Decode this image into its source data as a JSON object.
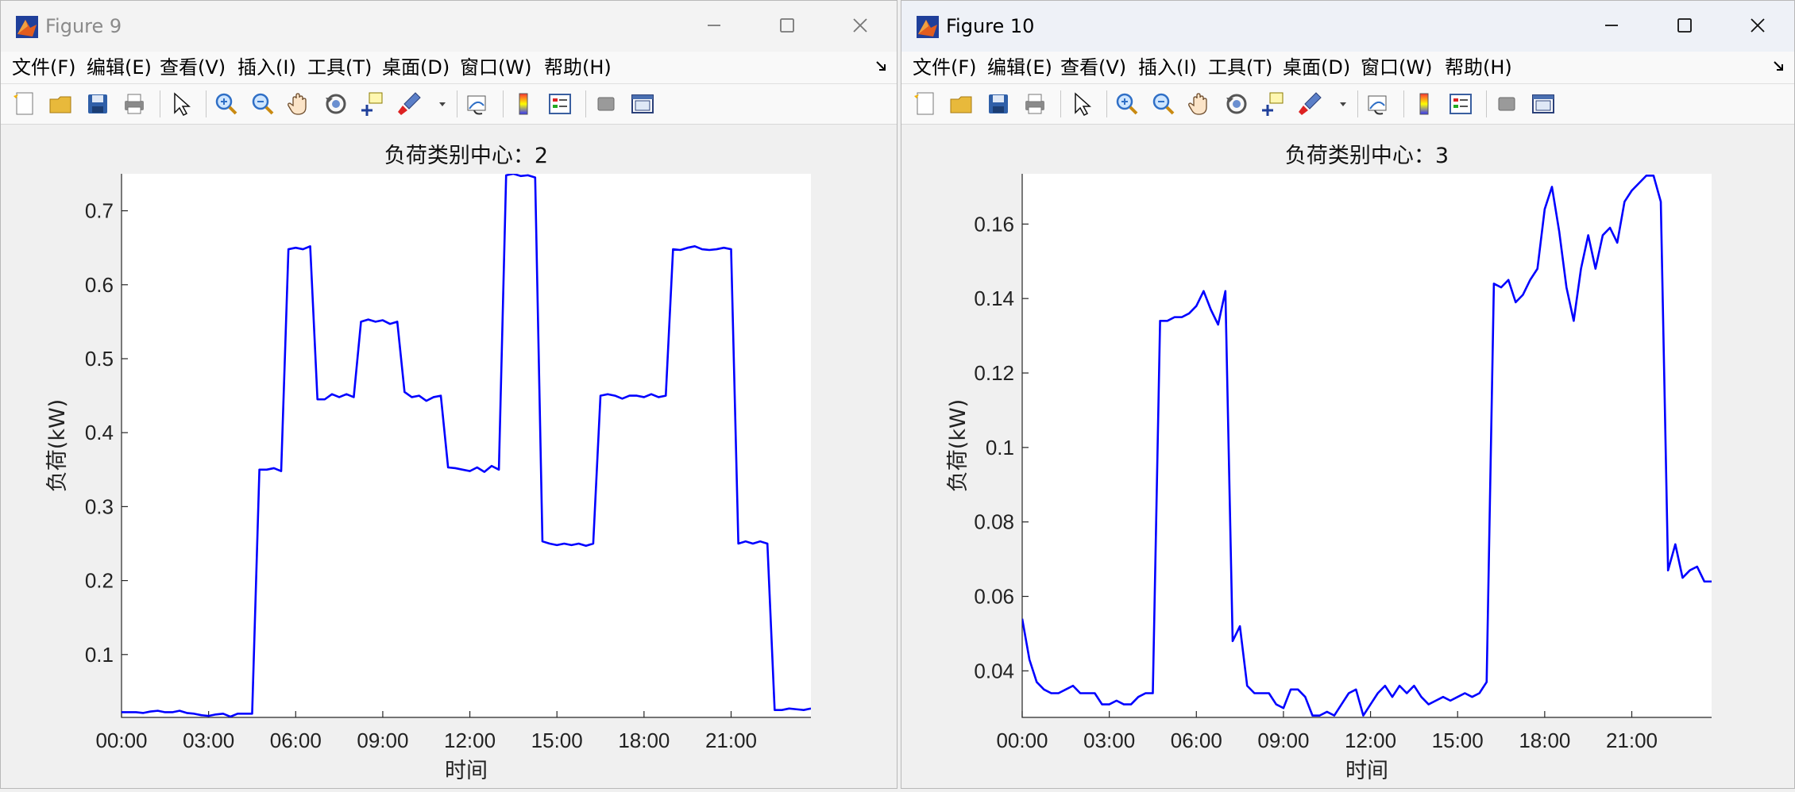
{
  "menu": [
    "文件(F)",
    "编辑(E)",
    "查看(V)",
    "插入(I)",
    "工具(T)",
    "桌面(D)",
    "窗口(W)",
    "帮助(H)"
  ],
  "windows": [
    {
      "title": "Figure 9",
      "active": false,
      "chart_data": {
        "type": "line",
        "title": "负荷类别中心：2",
        "xlabel": "时间",
        "ylabel": "负荷(kW)",
        "color": "#0000ff",
        "xlim": [
          0,
          95
        ],
        "ylim": [
          0.015,
          0.75
        ],
        "xticks": [
          0,
          12,
          24,
          36,
          48,
          60,
          72,
          84
        ],
        "xticklabels": [
          "00:00",
          "03:00",
          "06:00",
          "09:00",
          "12:00",
          "15:00",
          "18:00",
          "21:00"
        ],
        "yticks": [
          0.1,
          0.2,
          0.3,
          0.4,
          0.5,
          0.6,
          0.7
        ],
        "yticklabels": [
          "0.1",
          "0.2",
          "0.3",
          "0.4",
          "0.5",
          "0.6",
          "0.7"
        ],
        "grid": false,
        "values": [
          0.022,
          0.022,
          0.022,
          0.021,
          0.023,
          0.024,
          0.022,
          0.022,
          0.024,
          0.021,
          0.02,
          0.018,
          0.017,
          0.019,
          0.02,
          0.016,
          0.02,
          0.02,
          0.02,
          0.35,
          0.35,
          0.352,
          0.348,
          0.648,
          0.65,
          0.648,
          0.652,
          0.445,
          0.445,
          0.452,
          0.448,
          0.452,
          0.448,
          0.55,
          0.553,
          0.55,
          0.552,
          0.547,
          0.55,
          0.455,
          0.448,
          0.45,
          0.443,
          0.448,
          0.45,
          0.353,
          0.352,
          0.35,
          0.348,
          0.353,
          0.347,
          0.355,
          0.35,
          0.748,
          0.75,
          0.747,
          0.748,
          0.745,
          0.253,
          0.25,
          0.248,
          0.25,
          0.248,
          0.25,
          0.247,
          0.25,
          0.45,
          0.452,
          0.45,
          0.446,
          0.45,
          0.45,
          0.448,
          0.452,
          0.448,
          0.45,
          0.648,
          0.647,
          0.65,
          0.652,
          0.648,
          0.647,
          0.648,
          0.65,
          0.648,
          0.25,
          0.253,
          0.25,
          0.253,
          0.25,
          0.025,
          0.025,
          0.027,
          0.026,
          0.025,
          0.027
        ]
      }
    },
    {
      "title": "Figure 10",
      "active": true,
      "chart_data": {
        "type": "line",
        "title": "负荷类别中心：3",
        "xlabel": "时间",
        "ylabel": "负荷(kW)",
        "color": "#0000ff",
        "xlim": [
          0,
          95
        ],
        "ylim": [
          0.0275,
          0.1735
        ],
        "xticks": [
          0,
          12,
          24,
          36,
          48,
          60,
          72,
          84
        ],
        "xticklabels": [
          "00:00",
          "03:00",
          "06:00",
          "09:00",
          "12:00",
          "15:00",
          "18:00",
          "21:00"
        ],
        "yticks": [
          0.04,
          0.06,
          0.08,
          0.1,
          0.12,
          0.14,
          0.16
        ],
        "yticklabels": [
          "0.04",
          "0.06",
          "0.08",
          "0.1",
          "0.12",
          "0.14",
          "0.16"
        ],
        "grid": false,
        "values": [
          0.054,
          0.043,
          0.037,
          0.035,
          0.034,
          0.034,
          0.035,
          0.036,
          0.034,
          0.034,
          0.034,
          0.031,
          0.031,
          0.032,
          0.031,
          0.031,
          0.033,
          0.034,
          0.034,
          0.134,
          0.134,
          0.135,
          0.135,
          0.136,
          0.138,
          0.142,
          0.137,
          0.133,
          0.142,
          0.048,
          0.052,
          0.036,
          0.034,
          0.034,
          0.034,
          0.031,
          0.03,
          0.035,
          0.035,
          0.033,
          0.028,
          0.028,
          0.029,
          0.028,
          0.031,
          0.034,
          0.035,
          0.028,
          0.031,
          0.034,
          0.036,
          0.033,
          0.036,
          0.034,
          0.036,
          0.033,
          0.031,
          0.032,
          0.033,
          0.032,
          0.033,
          0.034,
          0.033,
          0.034,
          0.037,
          0.144,
          0.143,
          0.145,
          0.139,
          0.141,
          0.145,
          0.148,
          0.164,
          0.17,
          0.158,
          0.143,
          0.134,
          0.148,
          0.157,
          0.148,
          0.157,
          0.159,
          0.155,
          0.166,
          0.169,
          0.171,
          0.173,
          0.173,
          0.166,
          0.067,
          0.074,
          0.065,
          0.067,
          0.068,
          0.064,
          0.064
        ]
      }
    }
  ]
}
